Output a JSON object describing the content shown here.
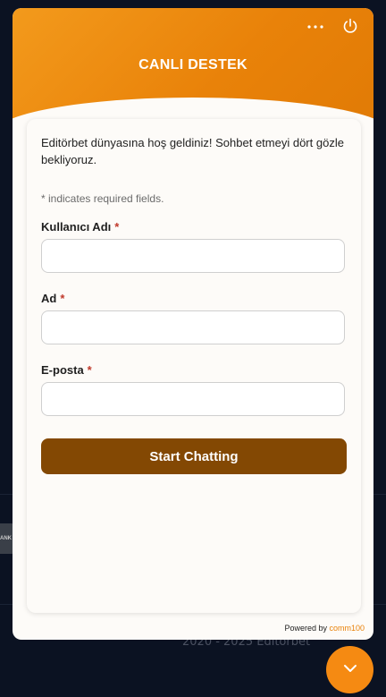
{
  "background": {
    "chip_text": "ANK",
    "footer_text": "2020 - 2025 Editörbet"
  },
  "header": {
    "title": "CANLI DESTEK",
    "menu_icon": "more-horizontal-icon",
    "power_icon": "power-icon"
  },
  "form": {
    "welcome_text": "Editörbet dünyasına hoş geldiniz! Sohbet etmeyi dört gözle bekliyoruz.",
    "required_note": "* indicates required fields.",
    "required_marker": "*",
    "fields": [
      {
        "label": "Kullanıcı Adı",
        "value": "",
        "placeholder": ""
      },
      {
        "label": "Ad",
        "value": "",
        "placeholder": ""
      },
      {
        "label": "E-posta",
        "value": "",
        "placeholder": ""
      }
    ],
    "submit_label": "Start Chatting"
  },
  "footer": {
    "powered_by": "Powered by",
    "brand": "comm100"
  },
  "fab": {
    "icon": "chevron-down-icon"
  },
  "colors": {
    "accent": "#e98209",
    "button": "#834803",
    "fab": "#f58a12",
    "page_bg": "#0b1222"
  }
}
